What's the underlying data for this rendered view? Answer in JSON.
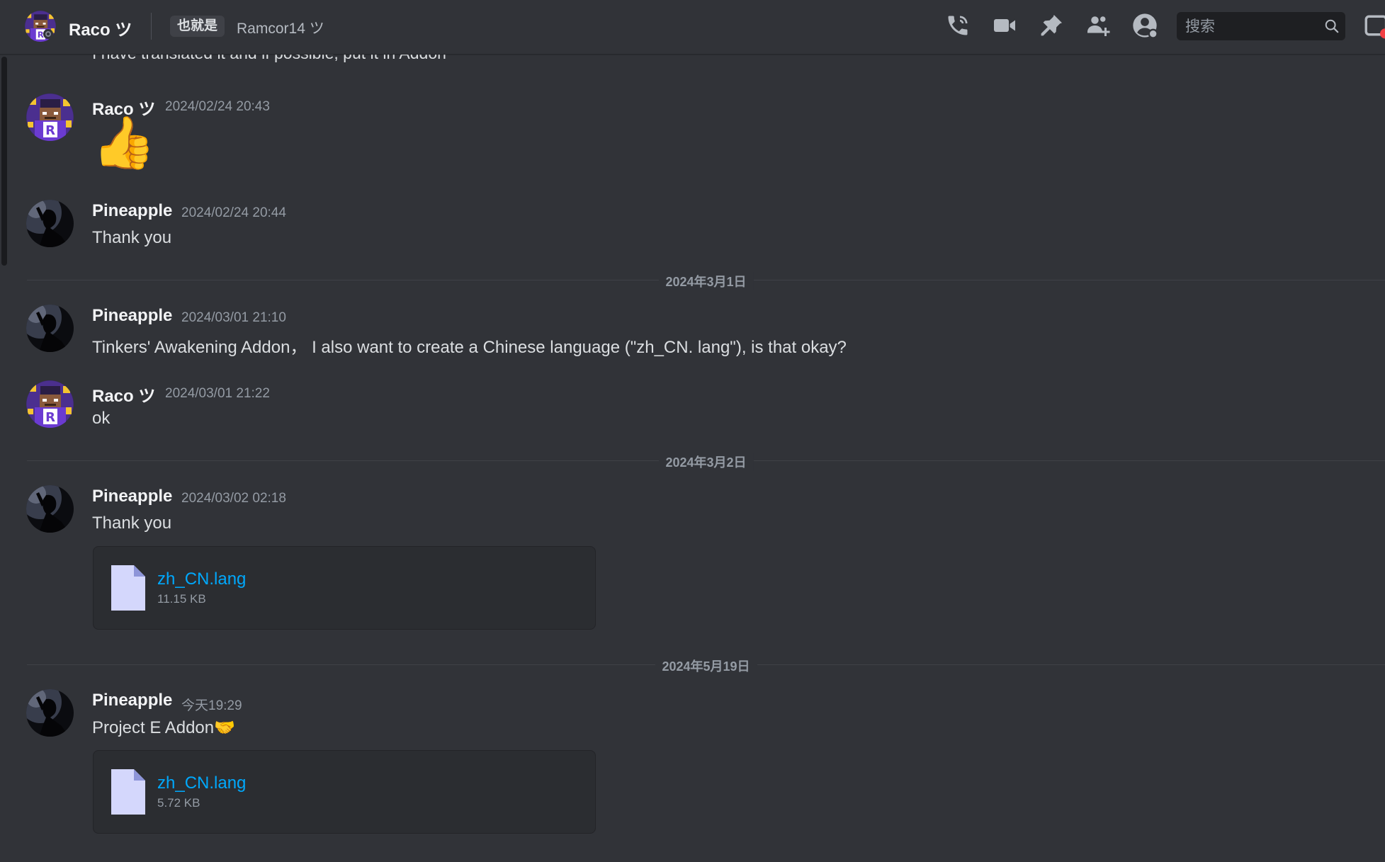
{
  "header": {
    "dm_name": "Raco ツ",
    "alias_tag": "也就是",
    "alias_name": "Ramcor14 ツ",
    "search_placeholder": "搜索",
    "icons": [
      "voice-call-icon",
      "video-call-icon",
      "pin-icon",
      "add-friends-icon",
      "user-profile-icon",
      "search-icon",
      "inbox-icon"
    ]
  },
  "top_clip": "I have translated it and if possible, put it in Addon",
  "messages": [
    {
      "author": "Raco ツ",
      "timestamp": "2024/02/24 20:43",
      "content": "👍"
    },
    {
      "author": "Pineapple",
      "timestamp": "2024/02/24 20:44",
      "content": "Thank you"
    },
    {
      "author": "Pineapple",
      "timestamp": "2024/03/01 21:10",
      "content": "Tinkers' Awakening Addon， I also want to create a Chinese language (\"zh_CN. lang\"), is that okay?"
    },
    {
      "author": "Raco ツ",
      "timestamp": "2024/03/01 21:22",
      "content": "ok"
    },
    {
      "author": "Pineapple",
      "timestamp": "2024/03/02 02:18",
      "content": "Thank you",
      "attachment": {
        "name": "zh_CN.lang",
        "size": "11.15 KB"
      }
    },
    {
      "author": "Pineapple",
      "timestamp": "今天19:29",
      "content": "Project E Addon🤝",
      "attachment": {
        "name": "zh_CN.lang",
        "size": "5.72 KB"
      }
    }
  ],
  "date_dividers": [
    "2024年3月1日",
    "2024年3月2日",
    "2024年5月19日"
  ],
  "colors": {
    "background": "#313338",
    "link": "#00a8fc",
    "timestamp": "#949ba4",
    "username": "#f2f3f5"
  }
}
